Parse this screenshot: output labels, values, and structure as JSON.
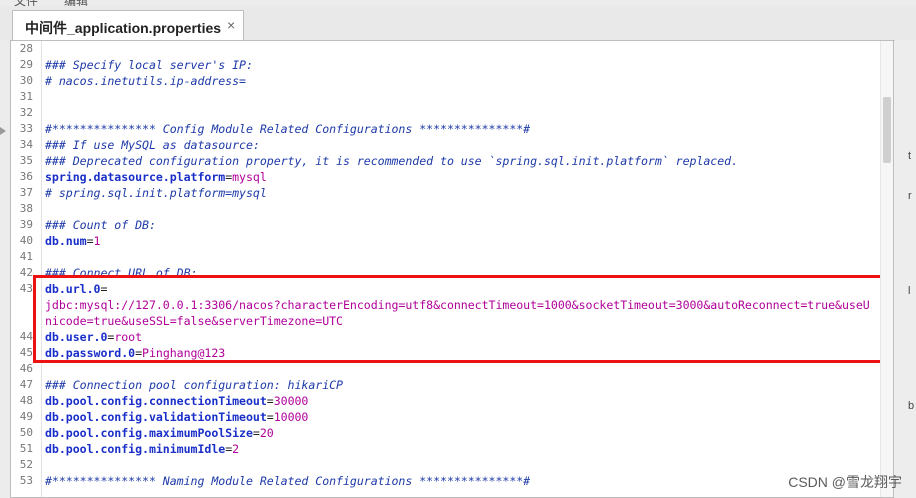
{
  "menu": {
    "items": [
      "文件",
      "编辑"
    ]
  },
  "tab": {
    "label": "中间件_application.properties",
    "close": "×"
  },
  "editor": {
    "lines": [
      {
        "n": "28",
        "parts": []
      },
      {
        "n": "29",
        "parts": [
          {
            "c": "comment",
            "t": "### Specify local server's IP:"
          }
        ]
      },
      {
        "n": "30",
        "parts": [
          {
            "c": "comment",
            "t": "# nacos.inetutils.ip-address="
          }
        ]
      },
      {
        "n": "31",
        "parts": []
      },
      {
        "n": "32",
        "parts": []
      },
      {
        "n": "33",
        "parts": [
          {
            "c": "comment",
            "t": "#*************** Config Module Related Configurations ***************#"
          }
        ]
      },
      {
        "n": "34",
        "parts": [
          {
            "c": "comment",
            "t": "### If use MySQL as datasource:"
          }
        ]
      },
      {
        "n": "35",
        "parts": [
          {
            "c": "comment",
            "t": "### Deprecated configuration property, it is recommended to use `spring.sql.init.platform` replaced."
          }
        ]
      },
      {
        "n": "36",
        "parts": [
          {
            "c": "key",
            "t": "spring.datasource.platform"
          },
          {
            "c": "eq",
            "t": "="
          },
          {
            "c": "val",
            "t": "mysql"
          }
        ]
      },
      {
        "n": "37",
        "parts": [
          {
            "c": "comment",
            "t": "# spring.sql.init.platform=mysql"
          }
        ]
      },
      {
        "n": "38",
        "parts": []
      },
      {
        "n": "39",
        "parts": [
          {
            "c": "comment",
            "t": "### Count of DB:"
          }
        ]
      },
      {
        "n": "40",
        "parts": [
          {
            "c": "key",
            "t": "db.num"
          },
          {
            "c": "eq",
            "t": "="
          },
          {
            "c": "val",
            "t": "1"
          }
        ]
      },
      {
        "n": "41",
        "parts": []
      },
      {
        "n": "42",
        "parts": [
          {
            "c": "comment",
            "t": "### Connect URL of DB:"
          }
        ]
      },
      {
        "n": "43",
        "parts": [
          {
            "c": "key",
            "t": "db.url.0"
          },
          {
            "c": "eq",
            "t": "="
          }
        ]
      },
      {
        "n": "",
        "parts": [
          {
            "c": "val",
            "t": "jdbc:mysql://127.0.0.1:3306/nacos?characterEncoding=utf8&connectTimeout=1000&socketTimeout=3000&autoReconnect=true&useU"
          }
        ]
      },
      {
        "n": "",
        "parts": [
          {
            "c": "val",
            "t": "nicode=true&useSSL=false&serverTimezone=UTC"
          }
        ]
      },
      {
        "n": "44",
        "parts": [
          {
            "c": "key",
            "t": "db.user.0"
          },
          {
            "c": "eq",
            "t": "="
          },
          {
            "c": "val",
            "t": "root"
          }
        ]
      },
      {
        "n": "45",
        "parts": [
          {
            "c": "key",
            "t": "db.password.0"
          },
          {
            "c": "eq",
            "t": "="
          },
          {
            "c": "val",
            "t": "Pinghang@123"
          }
        ]
      },
      {
        "n": "46",
        "parts": []
      },
      {
        "n": "47",
        "parts": [
          {
            "c": "comment",
            "t": "### Connection pool configuration: hikariCP"
          }
        ]
      },
      {
        "n": "48",
        "parts": [
          {
            "c": "key",
            "t": "db.pool.config.connectionTimeout"
          },
          {
            "c": "eq",
            "t": "="
          },
          {
            "c": "val",
            "t": "30000"
          }
        ]
      },
      {
        "n": "49",
        "parts": [
          {
            "c": "key",
            "t": "db.pool.config.validationTimeout"
          },
          {
            "c": "eq",
            "t": "="
          },
          {
            "c": "val",
            "t": "10000"
          }
        ]
      },
      {
        "n": "50",
        "parts": [
          {
            "c": "key",
            "t": "db.pool.config.maximumPoolSize"
          },
          {
            "c": "eq",
            "t": "="
          },
          {
            "c": "val",
            "t": "20"
          }
        ]
      },
      {
        "n": "51",
        "parts": [
          {
            "c": "key",
            "t": "db.pool.config.minimumIdle"
          },
          {
            "c": "eq",
            "t": "="
          },
          {
            "c": "val",
            "t": "2"
          }
        ]
      },
      {
        "n": "52",
        "parts": []
      },
      {
        "n": "53",
        "parts": [
          {
            "c": "comment",
            "t": "#*************** Naming Module Related Configurations ***************#"
          }
        ]
      }
    ]
  },
  "right_panel": {
    "chars": [
      "t",
      "r",
      "l",
      "b"
    ]
  },
  "watermark": "CSDN @雪龙翔宇",
  "colors": {
    "highlight": "#ee1111",
    "comment": "#1e3aa8",
    "key": "#1a2fc8",
    "value": "#b00098"
  }
}
